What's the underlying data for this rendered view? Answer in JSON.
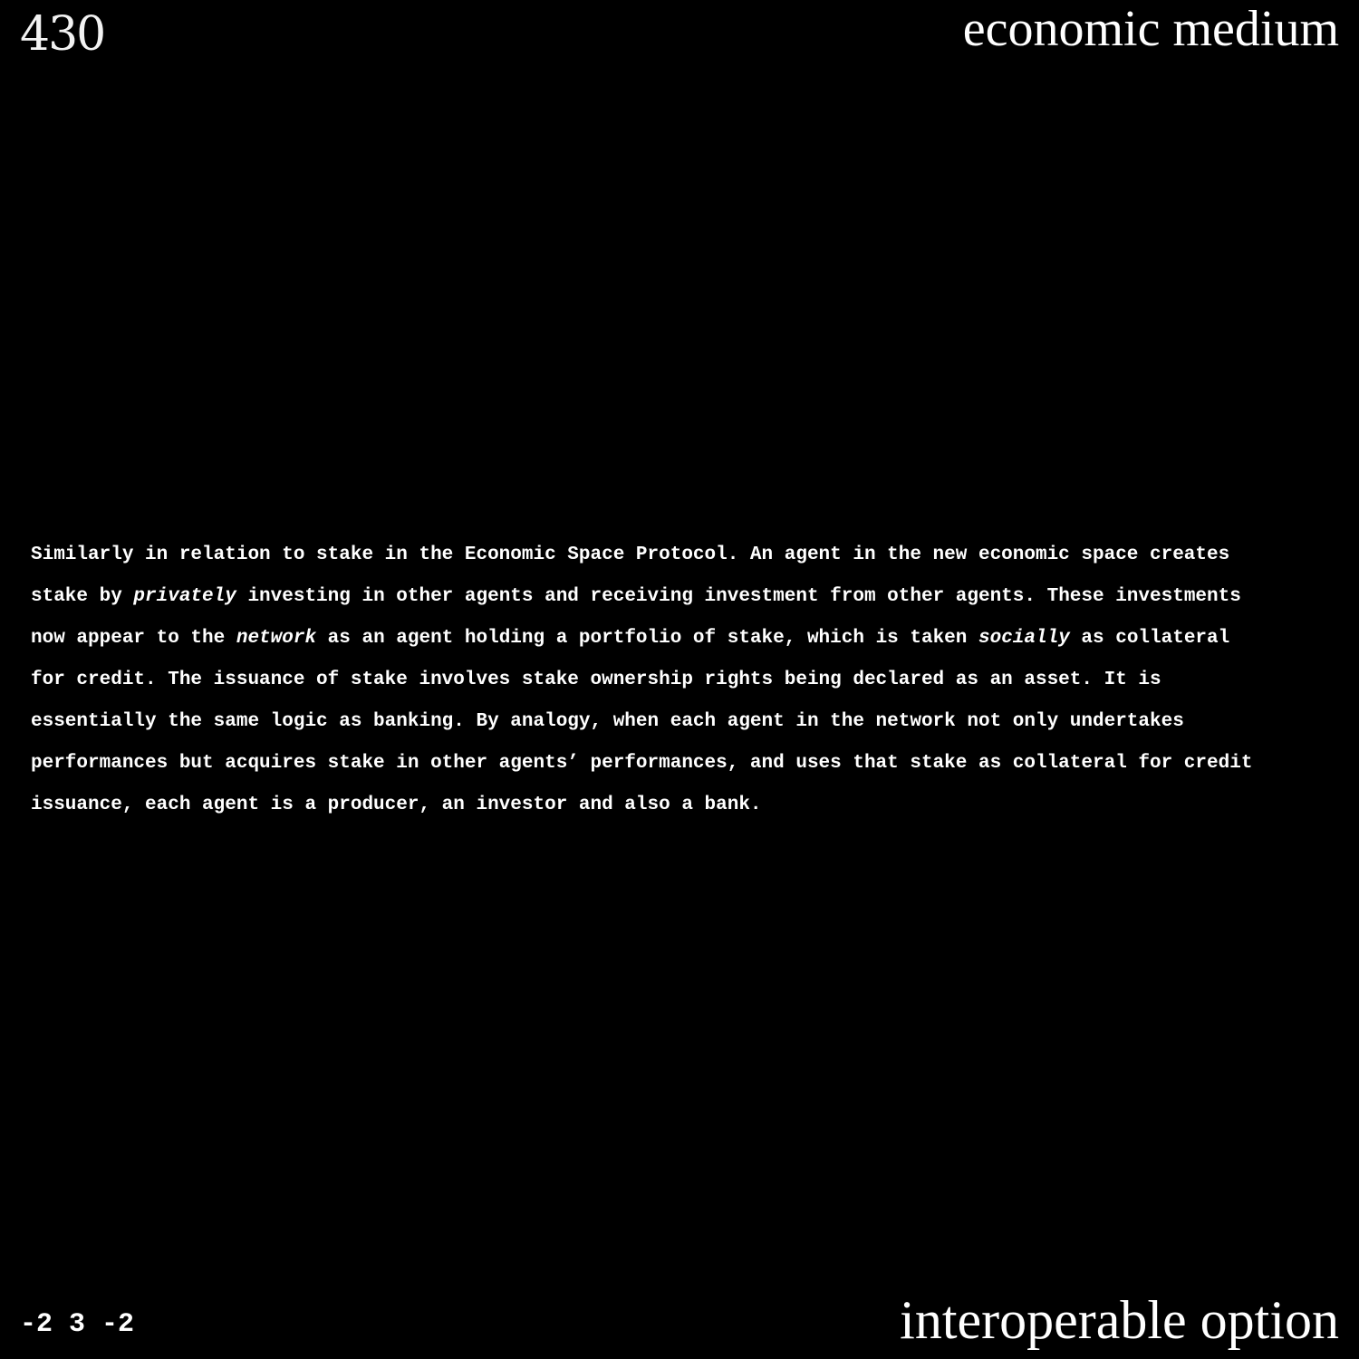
{
  "header": {
    "page_number": "430",
    "title": "economic medium"
  },
  "body": {
    "lines": [
      {
        "a": "Similarly in relation to stake in the Economic Space Protocol. An agent in the new economic space creates"
      },
      {
        "a": "stake by ",
        "em": "privately",
        "b": " investing in other agents and receiving investment from other agents. These investments"
      },
      {
        "a": "now appear to the ",
        "em": "network",
        "b": " as an agent holding a portfolio of stake, which is taken ",
        "em2": "socially",
        "c": " as collateral"
      },
      {
        "a": "for credit. The issuance of stake involves stake ownership rights being declared as an asset. It is"
      },
      {
        "a": "essentially the same logic as banking. By analogy, when each agent in the network not only undertakes"
      },
      {
        "a": "performances but acquires stake in other agents’ performances, and uses that stake as collateral for credit"
      },
      {
        "a": "issuance, each agent is a producer, an investor and also a bank."
      }
    ]
  },
  "footer": {
    "coordinates": "-2 3 -2",
    "title": "interoperable option"
  }
}
